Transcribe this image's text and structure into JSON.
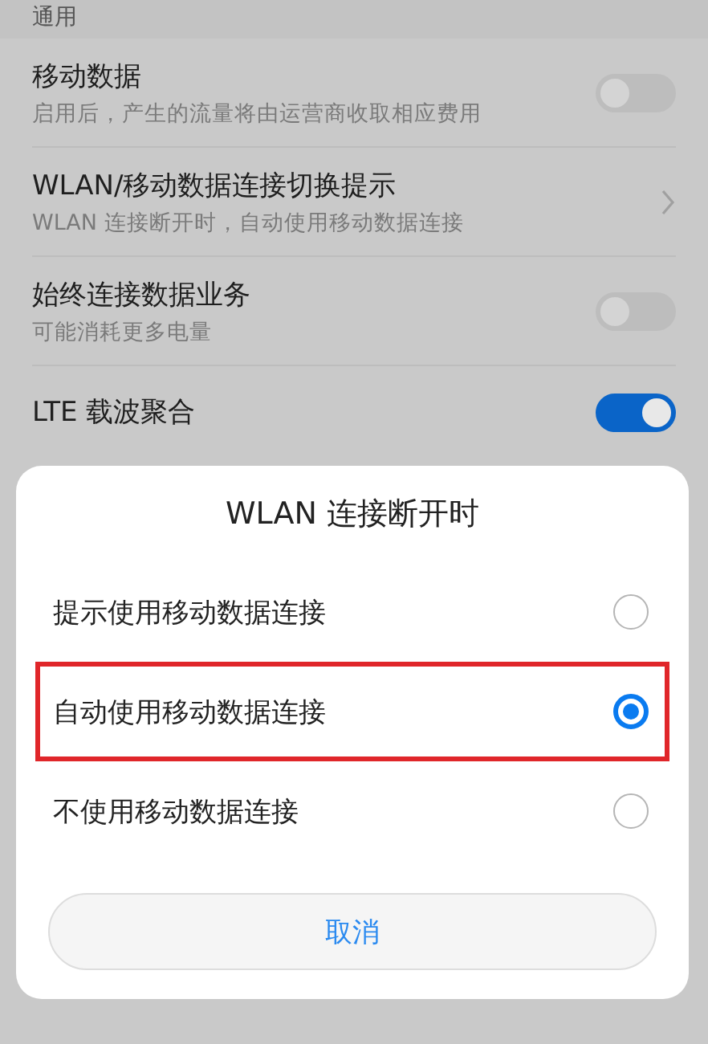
{
  "section": {
    "title": "通用"
  },
  "settings": [
    {
      "kind": "toggle",
      "title": "移动数据",
      "subtitle": "启用后，产生的流量将由运营商收取相应费用",
      "on": false
    },
    {
      "kind": "link",
      "title": "WLAN/移动数据连接切换提示",
      "subtitle": "WLAN 连接断开时，自动使用移动数据连接"
    },
    {
      "kind": "toggle",
      "title": "始终连接数据业务",
      "subtitle": "可能消耗更多电量",
      "on": false
    },
    {
      "kind": "toggle",
      "title": "LTE 载波聚合",
      "on": true
    }
  ],
  "dialog": {
    "title": "WLAN 连接断开时",
    "options": [
      {
        "label": "提示使用移动数据连接",
        "selected": false,
        "highlighted": false
      },
      {
        "label": "自动使用移动数据连接",
        "selected": true,
        "highlighted": true
      },
      {
        "label": "不使用移动数据连接",
        "selected": false,
        "highlighted": false
      }
    ],
    "cancel": "取消"
  }
}
